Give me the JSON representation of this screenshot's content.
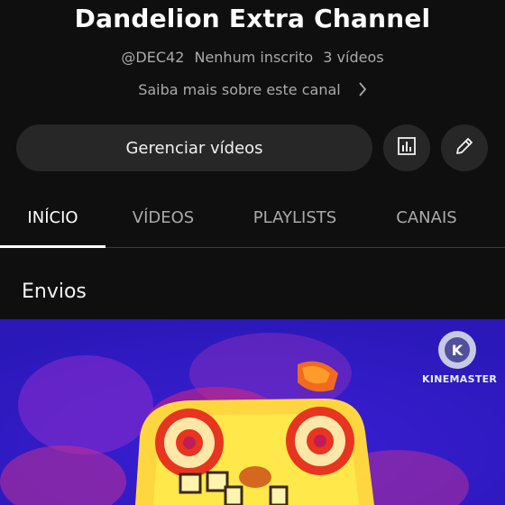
{
  "channel": {
    "name": "Dandelion Extra Channel",
    "handle": "@DEC42",
    "subscribers": "Nenhum inscrito",
    "video_count": "3 vídeos",
    "about_link": "Saiba mais sobre este canal"
  },
  "actions": {
    "manage_videos": "Gerenciar vídeos",
    "analytics_icon": "bar-chart-icon",
    "edit_icon": "pencil-icon"
  },
  "tabs": [
    {
      "label": "INÍCIO",
      "active": true
    },
    {
      "label": "VÍDEOS",
      "active": false
    },
    {
      "label": "PLAYLISTS",
      "active": false
    },
    {
      "label": "CANAIS",
      "active": false
    }
  ],
  "section": {
    "title": "Envios"
  },
  "thumbnail": {
    "watermark_label": "KINEMASTER"
  },
  "colors": {
    "background": "#0f0f0f",
    "button_bg": "#272727",
    "text_secondary": "#aaaaaa",
    "thumb_blue": "#3b1fd6",
    "thumb_magenta": "#d9267a",
    "thumb_yellow": "#ffe84a"
  }
}
